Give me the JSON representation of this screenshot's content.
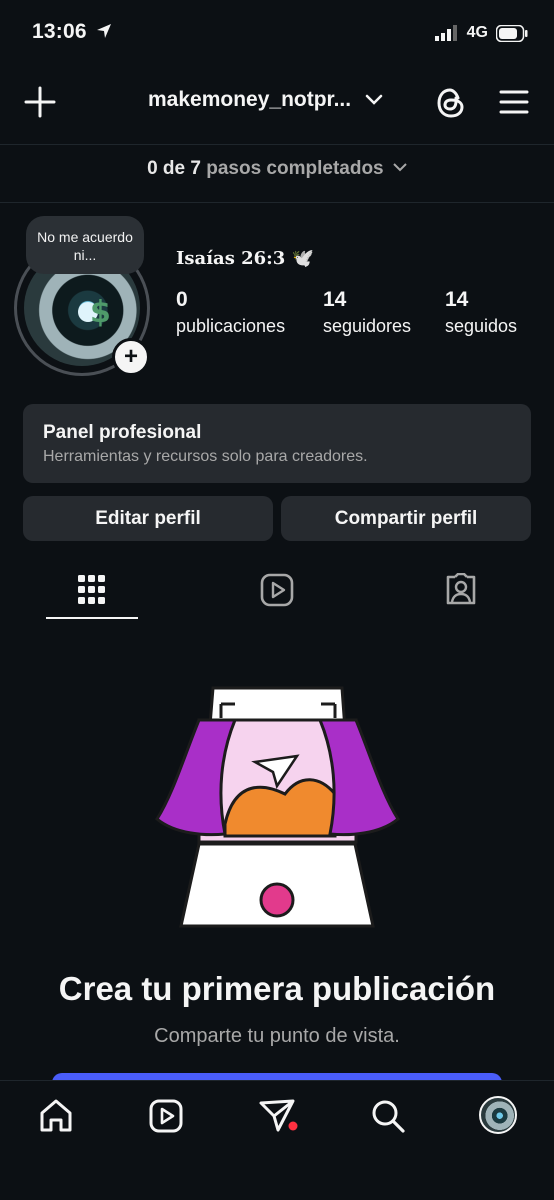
{
  "status_bar": {
    "time": "13:06",
    "network": "4G"
  },
  "header": {
    "username": "makemoney_notpr...",
    "icons": [
      "plus-icon",
      "chevron-down-icon",
      "threads-icon",
      "menu-icon"
    ]
  },
  "steps": {
    "done": "0 de 7",
    "rest": "pasos completados"
  },
  "profile": {
    "note": "No me acuerdo ni...",
    "bio": "Isaías 26:3 🕊️",
    "stats": [
      {
        "value": "0",
        "label": "publicaciones"
      },
      {
        "value": "14",
        "label": "seguidores"
      },
      {
        "value": "14",
        "label": "seguidos"
      }
    ]
  },
  "panel": {
    "title": "Panel profesional",
    "subtitle": "Herramientas y recursos solo para creadores."
  },
  "buttons": {
    "edit": "Editar perfil",
    "share": "Compartir perfil"
  },
  "tabs": [
    "grid-icon",
    "reels-icon",
    "tagged-icon"
  ],
  "empty_state": {
    "title": "Crea tu primera publicación",
    "subtitle": "Comparte tu punto de vista."
  },
  "nav": [
    "home-icon",
    "reels-icon",
    "messages-icon",
    "search-icon",
    "profile-avatar"
  ],
  "colors": {
    "bg": "#0c1014",
    "card": "#262a2f",
    "accent": "#4a5df9",
    "notify": "#ff3040"
  }
}
